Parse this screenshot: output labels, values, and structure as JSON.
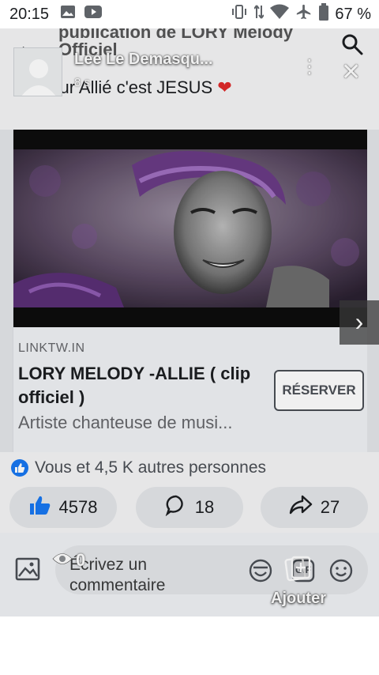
{
  "status_bar": {
    "time": "20:15",
    "battery": "67 %"
  },
  "shared_screen": {
    "header_title": "publication de LORY Melody Officiel",
    "post_text": "Meilleur Allié c'est JESUS",
    "heart": "❤"
  },
  "story": {
    "user_name": "Lee Le Demasqu...",
    "time_ago": "8 s",
    "views": "0",
    "add_label": "Ajouter"
  },
  "link_card": {
    "domain": "LINKTW.IN",
    "title": "LORY MELODY -ALLIE ( clip officiel )",
    "description": "Artiste chanteuse de musi...",
    "button_label": "RÉSERVER"
  },
  "reactions": {
    "summary": "Vous et 4,5 K autres personnes",
    "like_count": "4578",
    "comment_count": "18",
    "share_count": "27"
  },
  "comment_box": {
    "placeholder": "Écrivez un commentaire",
    "gif_label": "GIF"
  },
  "colors": {
    "facebook_blue": "#1877f2",
    "heart_red": "#e02a2a",
    "card_bg": "#f0f2f5"
  }
}
